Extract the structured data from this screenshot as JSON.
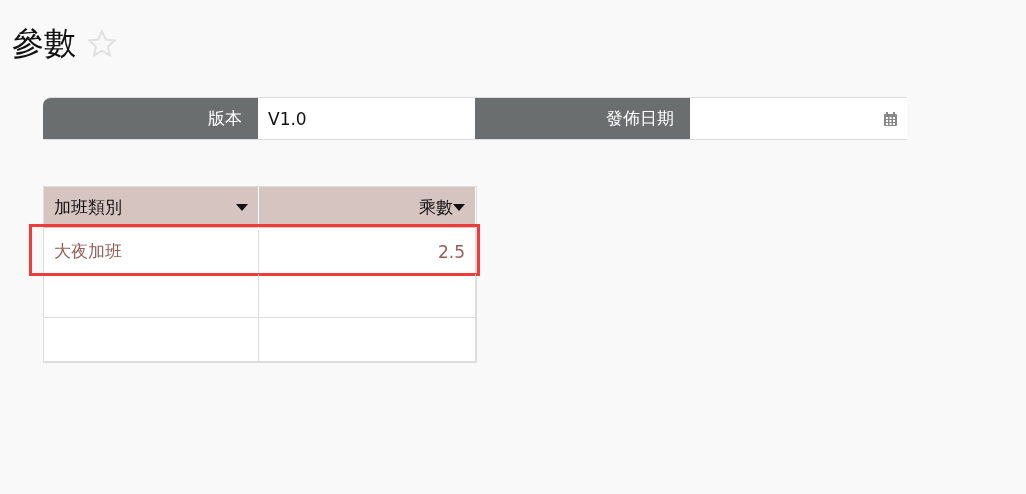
{
  "page": {
    "title": "參數",
    "starred": false
  },
  "form_fields": [
    {
      "label": "版本",
      "value": "V1.0",
      "kind": "text"
    },
    {
      "label": "發佈日期",
      "kind": "date"
    }
  ],
  "table": {
    "columns": [
      {
        "label": "加班類別",
        "kind": "text"
      },
      {
        "label": "乘數",
        "kind": "number"
      }
    ],
    "rows": [
      {
        "cells": [
          "大夜加班",
          "2.5"
        ],
        "highlighted": true
      },
      {
        "cells": [],
        "highlighted": false
      },
      {
        "cells": [],
        "highlighted": false
      }
    ]
  }
}
